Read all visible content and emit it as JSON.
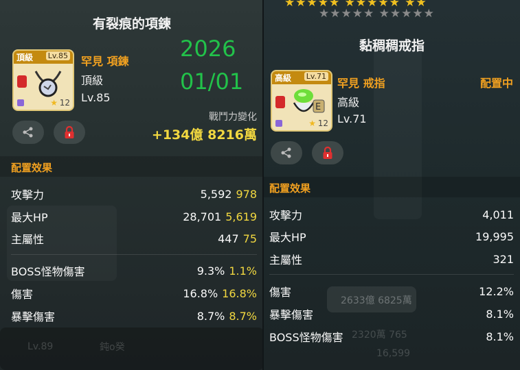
{
  "left": {
    "title": "有裂痕的項鍊",
    "item": {
      "grade_badge": "頂級",
      "level_badge": "Lv.85",
      "star_count": "12",
      "rarity_name": "罕見 項鍊",
      "tier": "頂級",
      "level": "Lv.85",
      "icon": "cracked-necklace-icon"
    },
    "date_line1": "2026",
    "date_line2": "01/01",
    "power_change_label": "戰鬥力變化",
    "power_change_value": "+134億 8216萬",
    "equip_effect_label": "配置效果",
    "stats": [
      {
        "label": "攻擊力",
        "base": "5,592",
        "bonus": "978"
      },
      {
        "label": "最大HP",
        "base": "28,701",
        "bonus": "5,619"
      },
      {
        "label": "主屬性",
        "base": "447",
        "bonus": "75"
      }
    ],
    "sub_stats": [
      {
        "label": "BOSS怪物傷害",
        "base": "9.3%",
        "bonus": "1.1%"
      },
      {
        "label": "傷害",
        "base": "16.8%",
        "bonus": "16.8%"
      },
      {
        "label": "暴擊傷害",
        "base": "8.7%",
        "bonus": "8.7%"
      }
    ],
    "bg_footer_left": "Lv.89",
    "bg_footer_mid": "鈍o癸"
  },
  "right": {
    "title": "黏稠稠戒指",
    "item": {
      "grade_badge": "高級",
      "level_badge": "Lv.71",
      "star_count": "12",
      "rarity_name": "罕見 戒指",
      "tier": "高級",
      "level": "Lv.71",
      "icon": "sticky-ring-icon"
    },
    "equipped_label": "配置中",
    "equip_effect_label": "配置效果",
    "stats": [
      {
        "label": "攻擊力",
        "value": "4,011"
      },
      {
        "label": "最大HP",
        "value": "19,995"
      },
      {
        "label": "主屬性",
        "value": "321"
      }
    ],
    "sub_stats": [
      {
        "label": "傷害",
        "value": "12.2%"
      },
      {
        "label": "暴擊傷害",
        "value": "8.1%"
      },
      {
        "label": "BOSS怪物傷害",
        "value": "8.1%"
      }
    ],
    "bg_text_1": "2633億 6825萬",
    "bg_text_2": "2320萬 765",
    "bg_text_3": "16,599",
    "stars_top_gold": "★★★★★ ★★★★★ ★★",
    "stars_top_grey": "★★★★★ ★★★★★"
  },
  "colors": {
    "rarity": "#f0a020",
    "bonus": "#f2d840",
    "date": "#22c24a",
    "equipped": "#f0a020"
  }
}
